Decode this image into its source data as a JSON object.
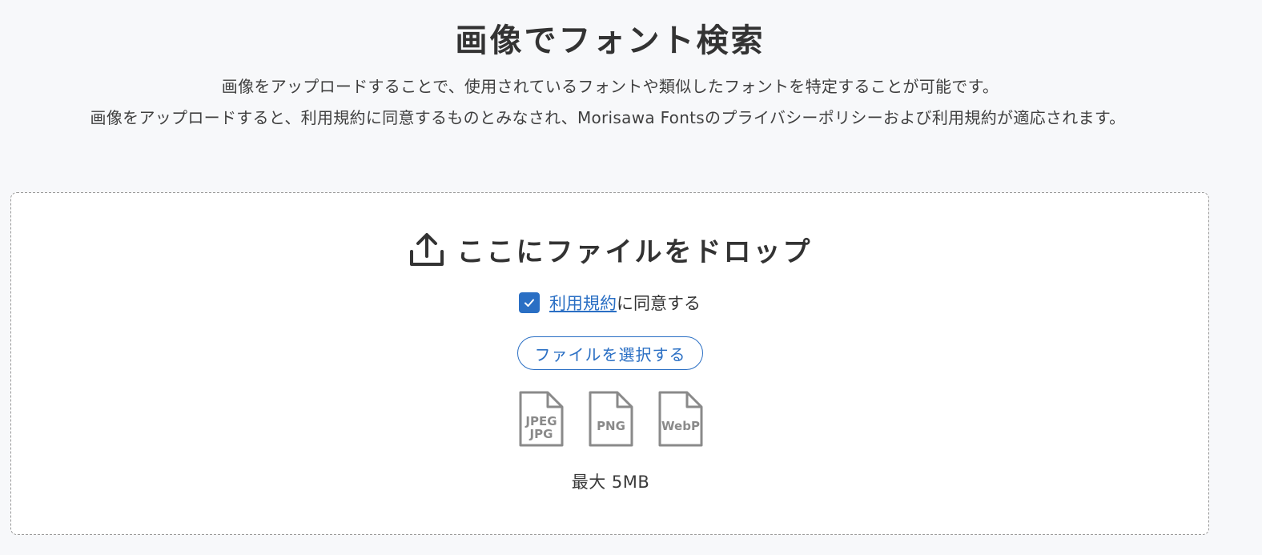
{
  "header": {
    "title": "画像でフォント検索",
    "description_line1": "画像をアップロードすることで、使用されているフォントや類似したフォントを特定することが可能です。",
    "description_line2": "画像をアップロードすると、利用規約に同意するものとみなされ、Morisawa Fontsのプライバシーポリシーおよび利用規約が適応されます。"
  },
  "dropzone": {
    "icon": "upload-icon",
    "label": "ここにファイルをドロップ",
    "agree": {
      "checked": true,
      "link_text": "利用規約",
      "suffix": "に同意する"
    },
    "select_button_label": "ファイルを選択する",
    "file_types": [
      {
        "line1": "JPEG",
        "line2": "JPG"
      },
      {
        "line1": "PNG",
        "line2": ""
      },
      {
        "line1": "WebP",
        "line2": ""
      }
    ],
    "max_size": "最大 5MB"
  },
  "colors": {
    "accent": "#2a6fc4",
    "background": "#f7f8fa",
    "text": "#333333",
    "icon_gray": "#8a8a8a"
  }
}
